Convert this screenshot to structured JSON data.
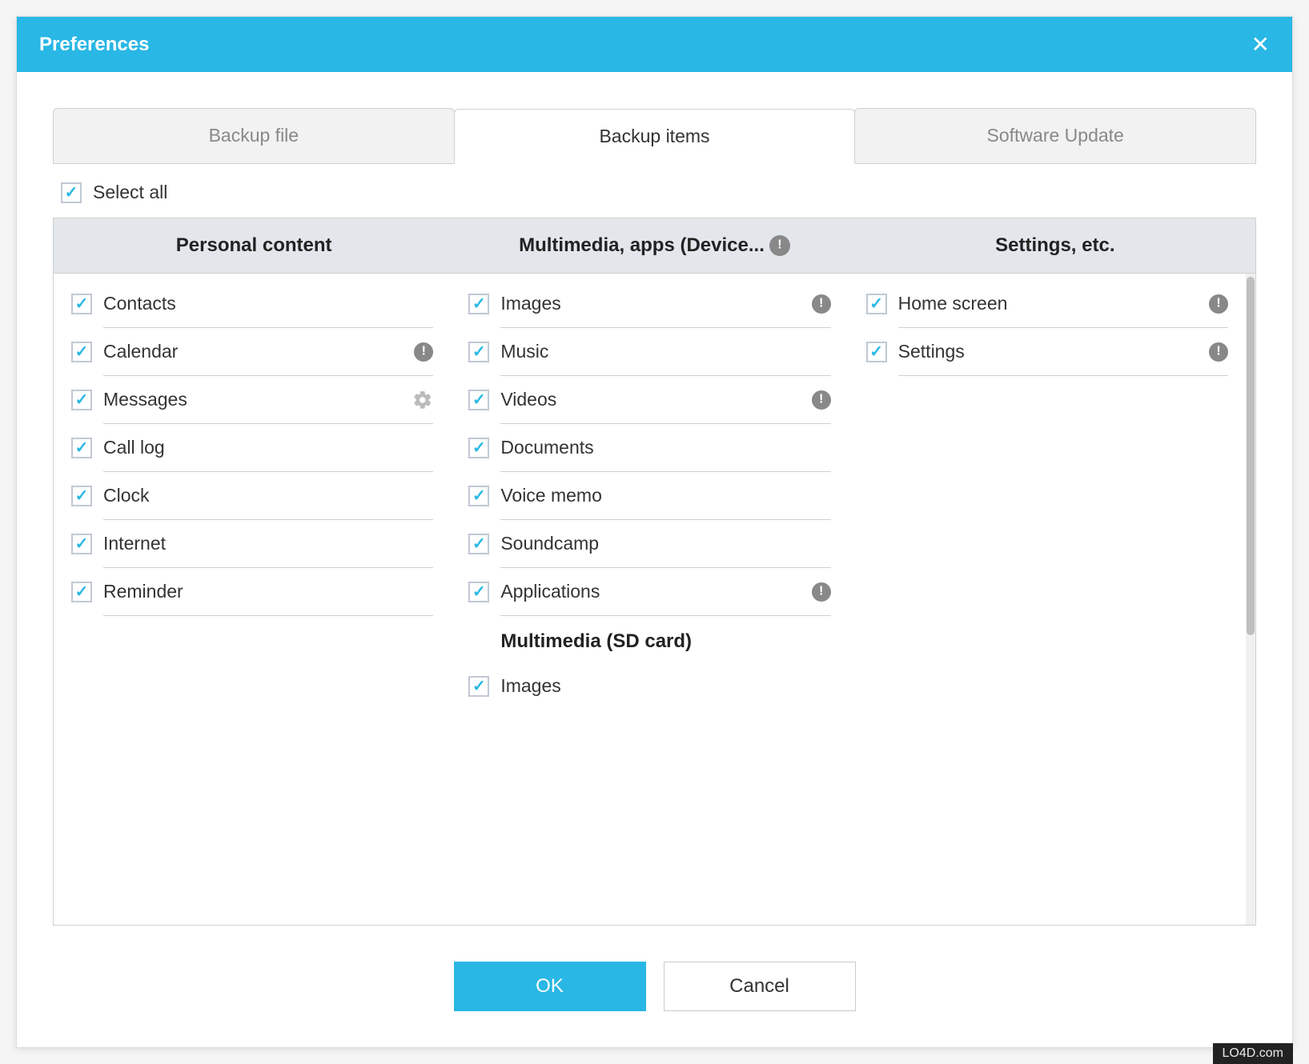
{
  "title": "Preferences",
  "tabs": [
    {
      "label": "Backup file"
    },
    {
      "label": "Backup items"
    },
    {
      "label": "Software Update"
    }
  ],
  "select_all_label": "Select all",
  "columns": {
    "personal": {
      "header": "Personal content"
    },
    "multimedia": {
      "header": "Multimedia, apps (Device..."
    },
    "settings": {
      "header": "Settings, etc."
    }
  },
  "items": {
    "personal": [
      {
        "label": "Contacts"
      },
      {
        "label": "Calendar"
      },
      {
        "label": "Messages"
      },
      {
        "label": "Call log"
      },
      {
        "label": "Clock"
      },
      {
        "label": "Internet"
      },
      {
        "label": "Reminder"
      }
    ],
    "multimedia_device": [
      {
        "label": "Images"
      },
      {
        "label": "Music"
      },
      {
        "label": "Videos"
      },
      {
        "label": "Documents"
      },
      {
        "label": "Voice memo"
      },
      {
        "label": "Soundcamp"
      },
      {
        "label": "Applications"
      }
    ],
    "multimedia_sd_header": "Multimedia (SD card)",
    "multimedia_sd": [
      {
        "label": "Images"
      }
    ],
    "settings": [
      {
        "label": "Home screen"
      },
      {
        "label": "Settings"
      }
    ]
  },
  "buttons": {
    "ok": "OK",
    "cancel": "Cancel"
  },
  "watermark": "LO4D.com"
}
